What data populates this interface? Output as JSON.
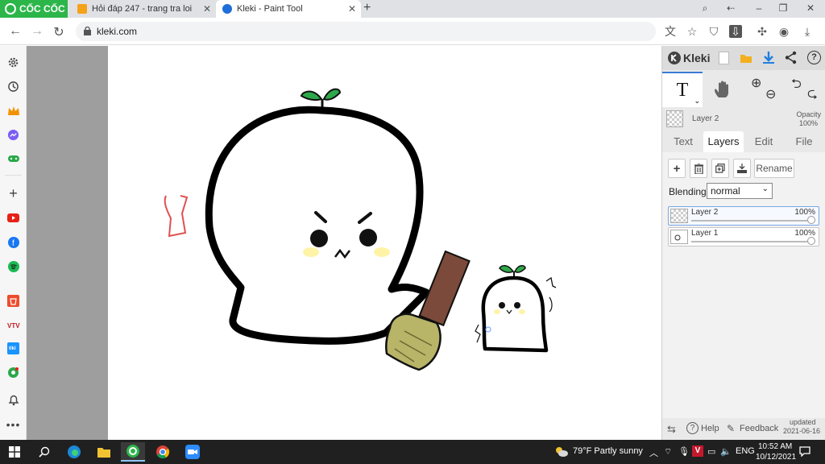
{
  "browser": {
    "brand": "CỐC CỐC",
    "tabs": [
      {
        "title": "Hỏi đáp 247 - trang tra loi",
        "active": false
      },
      {
        "title": "Kleki - Paint Tool",
        "active": true
      }
    ],
    "url": "kleki.com"
  },
  "kleki": {
    "app_name": "Kleki",
    "current_layer": {
      "name": "Layer 2",
      "opacity_label": "Opacity",
      "opacity_value": "100%"
    },
    "tabs": [
      "Text",
      "Layers",
      "Edit",
      "File"
    ],
    "active_tab": "Layers",
    "rename_label": "Rename",
    "blending_label": "Blending",
    "blending_value": "normal",
    "layers": [
      {
        "name": "Layer 2",
        "opacity": "100%",
        "selected": true
      },
      {
        "name": "Layer 1",
        "opacity": "100%",
        "selected": false
      }
    ],
    "footer": {
      "help": "Help",
      "feedback": "Feedback",
      "updated_line1": "updated",
      "updated_line2": "2021-06-16"
    }
  },
  "taskbar": {
    "weather": "79°F  Partly sunny",
    "lang": "ENG",
    "time": "10:52 AM",
    "date": "10/12/2021"
  },
  "colors": {
    "brand_green": "#2cb64a",
    "canvas_gray": "#9e9e9e",
    "taskbar": "#202020",
    "broom_handle": "#7b4a3a",
    "broom_head": "#b8b468"
  }
}
